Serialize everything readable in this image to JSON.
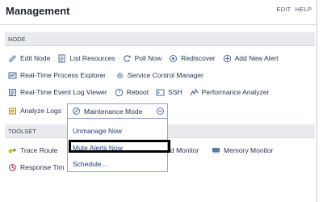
{
  "header": {
    "title": "Management",
    "edit": "EDIT",
    "help": "HELP"
  },
  "node": {
    "section": "NODE",
    "row1": [
      "Edit Node",
      "List Resources",
      "Poll Now",
      "Rediscover",
      "Add New Alert"
    ],
    "row2": [
      "Real-Time Process Explorer",
      "Service Control Manager"
    ],
    "row3": [
      "Real-Time Event Log Viewer",
      "Reboot",
      "SSH",
      "Performance Analyzer"
    ],
    "row4": [
      "Analyze Logs"
    ]
  },
  "maintenance": {
    "button": "Maintenance Mode",
    "options": [
      "Unmanage Now",
      "Mute Alerts Now",
      "Schedule..."
    ]
  },
  "toolset": {
    "section": "TOOLSET",
    "row1_left": "Trace Route",
    "row1_mid": "d Monitor",
    "row1_right": "Memory Monitor",
    "row2_left": "Response Tim"
  }
}
